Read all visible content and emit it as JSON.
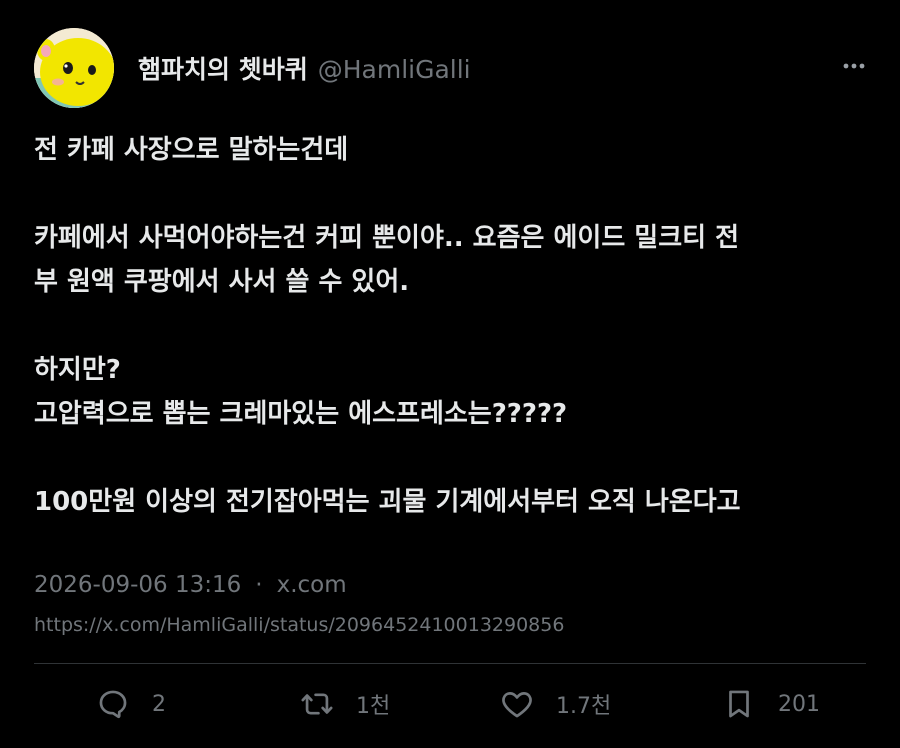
{
  "author": {
    "display_name": "햄파치의 쳇바퀴",
    "handle": "@HamliGalli",
    "avatar_icon": "hamster-avatar"
  },
  "post": {
    "lines": [
      "전 카페 사장으로 말하는건데",
      "",
      "카페에서 사먹어야하는건 커피 뿐이야.. 요즘은 에이드 밀크티 전",
      "부 원액 쿠팡에서 사서 쓸 수 있어.",
      "",
      "하지만?",
      "고압력으로 뽑는 크레마있는 에스프레소는?????",
      "",
      "100만원 이상의 전기잡아먹는 괴물 기계에서부터 오직 나온다고"
    ]
  },
  "meta": {
    "timestamp": "2026-09-06 13:16",
    "separator": "·",
    "source": "x.com",
    "url": "https://x.com/HamliGalli/status/2096452410013290856"
  },
  "actions": {
    "replies": "2",
    "reposts": "1천",
    "likes": "1.7천",
    "bookmarks": "201"
  },
  "colors": {
    "background": "#000000",
    "text": "#e7e9ea",
    "muted": "#71767b",
    "divider": "#2f3336",
    "avatar_yellow": "#f2e600"
  }
}
